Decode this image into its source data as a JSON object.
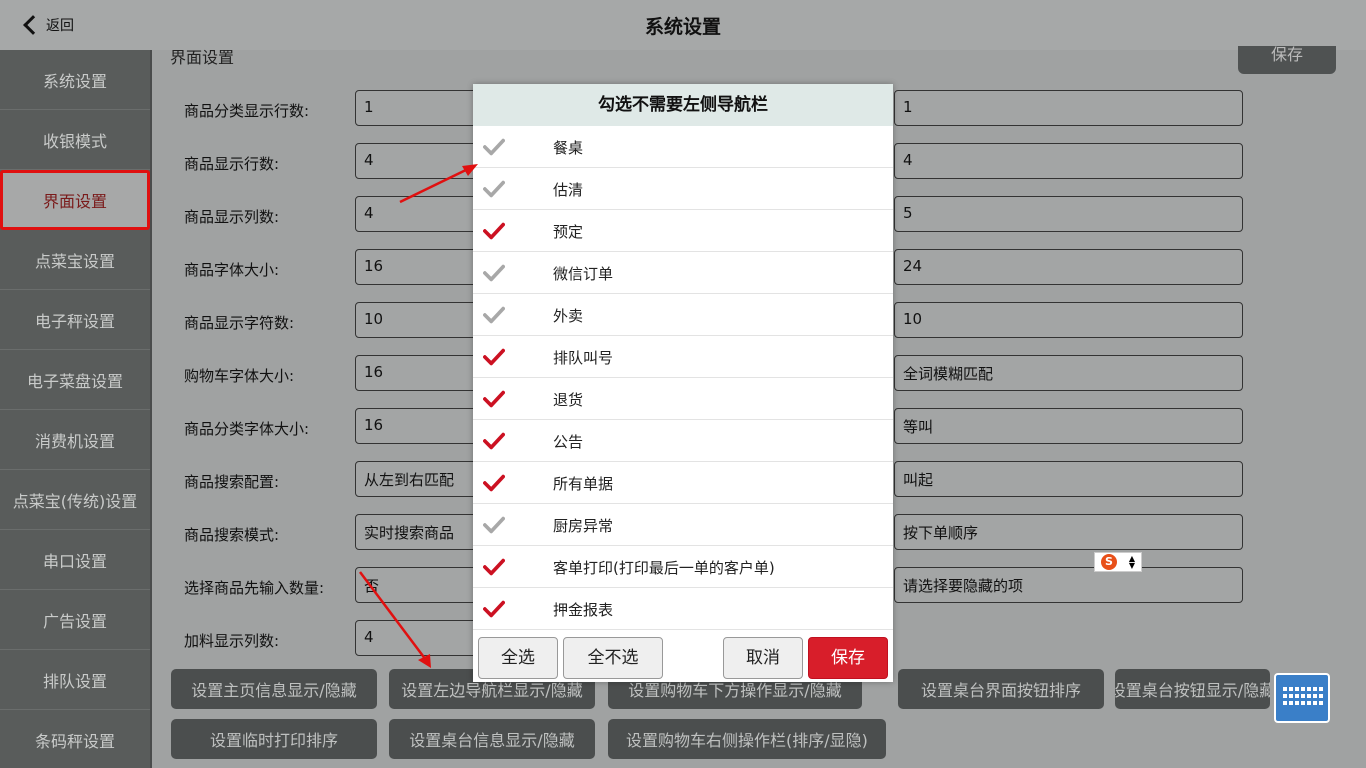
{
  "header": {
    "back_label": "返回",
    "title": "系统设置"
  },
  "sidebar": {
    "items": [
      {
        "label": "系统设置",
        "active": false
      },
      {
        "label": "收银模式",
        "active": false
      },
      {
        "label": "界面设置",
        "active": true
      },
      {
        "label": "点菜宝设置",
        "active": false
      },
      {
        "label": "电子秤设置",
        "active": false
      },
      {
        "label": "电子菜盘设置",
        "active": false
      },
      {
        "label": "消费机设置",
        "active": false
      },
      {
        "label": "点菜宝(传统)设置",
        "active": false
      },
      {
        "label": "串口设置",
        "active": false
      },
      {
        "label": "广告设置",
        "active": false
      },
      {
        "label": "排队设置",
        "active": false
      },
      {
        "label": "条码秤设置",
        "active": false
      }
    ]
  },
  "main": {
    "section_title": "界面设置",
    "save_label": "保存",
    "rows": [
      {
        "label": "商品分类显示行数:",
        "left": "1",
        "right": "1"
      },
      {
        "label": "商品显示行数:",
        "left": "4",
        "right": "4"
      },
      {
        "label": "商品显示列数:",
        "left": "4",
        "right": "5"
      },
      {
        "label": "商品字体大小:",
        "left": "16",
        "right": "24"
      },
      {
        "label": "商品显示字符数:",
        "left": "10",
        "right": "10"
      },
      {
        "label": "购物车字体大小:",
        "left": "16",
        "right": "全词模糊匹配"
      },
      {
        "label": "商品分类字体大小:",
        "left": "16",
        "right": "等叫"
      },
      {
        "label": "商品搜索配置:",
        "left": "从左到右匹配",
        "right": "叫起"
      },
      {
        "label": "商品搜索模式:",
        "left": "实时搜索商品",
        "right": "按下单顺序"
      },
      {
        "label": "选择商品先输入数量:",
        "left": "否",
        "right": "请选择要隐藏的项"
      },
      {
        "label": "加料显示列数:",
        "left": "4",
        "right": ""
      }
    ],
    "buttons_row1": [
      "设置主页信息显示/隐藏",
      "设置左边导航栏显示/隐藏",
      "设置购物车下方操作显示/隐藏",
      "设置桌台界面按钮排序",
      "设置桌台按钮显示/隐藏"
    ],
    "buttons_row2": [
      "设置临时打印排序",
      "设置桌台信息显示/隐藏",
      "设置购物车右侧操作栏(排序/显隐)"
    ]
  },
  "modal": {
    "title": "勾选不需要左侧导航栏",
    "options": [
      {
        "label": "餐桌",
        "checked": false
      },
      {
        "label": "估清",
        "checked": false
      },
      {
        "label": "预定",
        "checked": true
      },
      {
        "label": "微信订单",
        "checked": false
      },
      {
        "label": "外卖",
        "checked": false
      },
      {
        "label": "排队叫号",
        "checked": true
      },
      {
        "label": "退货",
        "checked": true
      },
      {
        "label": "公告",
        "checked": true
      },
      {
        "label": "所有单据",
        "checked": true
      },
      {
        "label": "厨房异常",
        "checked": false
      },
      {
        "label": "客单打印(打印最后一单的客户单)",
        "checked": true
      },
      {
        "label": "押金报表",
        "checked": true
      }
    ],
    "select_all": "全选",
    "select_none": "全不选",
    "cancel": "取消",
    "save": "保存"
  },
  "colors": {
    "checked": "#cc1122",
    "unchecked": "#a8a8a8",
    "accent_red": "#d81e2a"
  }
}
